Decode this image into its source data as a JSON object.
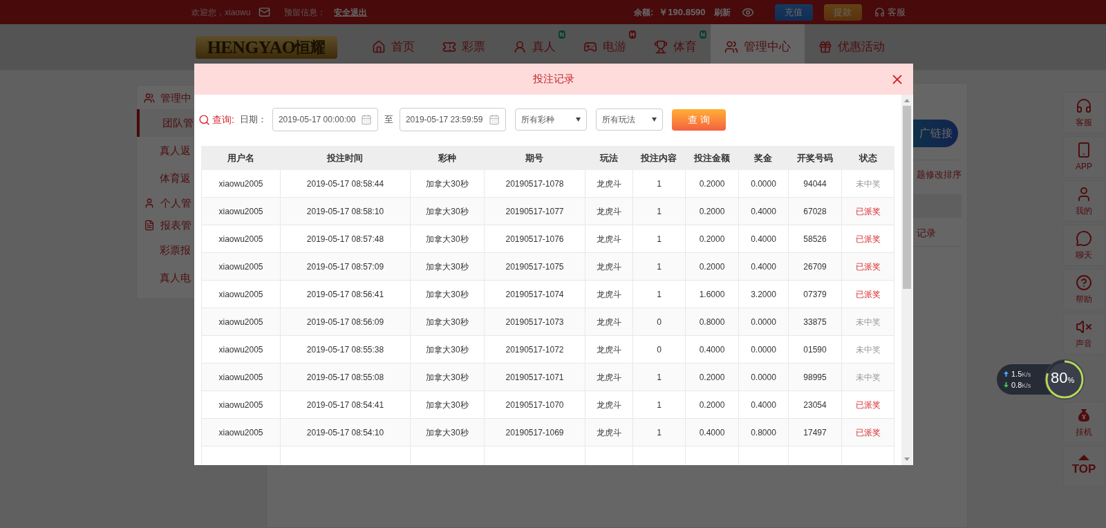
{
  "topbar": {
    "welcome": "欢迎您，xiaowu",
    "reserved_label": "预留信息：",
    "logout": "安全退出",
    "balance_label": "余额:",
    "balance": "￥190.8590",
    "refresh": "刷新",
    "buttons": [
      {
        "label": "充值",
        "kind": "deposit"
      },
      {
        "label": "提款",
        "kind": "withdraw"
      }
    ],
    "service": "客服"
  },
  "logo": {
    "latin": "HENGYAO",
    "cjk": "恒耀"
  },
  "nav": [
    {
      "label": "首页",
      "selected": false
    },
    {
      "label": "彩票",
      "selected": false
    },
    {
      "label": "真人",
      "selected": false,
      "badge": {
        "text": "N",
        "kind": "new"
      }
    },
    {
      "label": "电游",
      "selected": false,
      "badge": {
        "text": "H",
        "kind": "hot"
      }
    },
    {
      "label": "体育",
      "selected": false,
      "badge": {
        "text": "N",
        "kind": "new"
      }
    },
    {
      "label": "管理中心",
      "selected": true
    },
    {
      "label": "优惠活动",
      "selected": false
    }
  ],
  "sidebar": [
    {
      "label": "管理中",
      "children": [
        {
          "label": "团队管",
          "selected": true
        },
        {
          "label": "真人返",
          "selected": false
        },
        {
          "label": "体育返",
          "selected": false
        }
      ]
    },
    {
      "label": "个人管"
    },
    {
      "label": "报表管",
      "children": [
        {
          "label": "彩票报",
          "selected": false
        },
        {
          "label": "真人电",
          "selected": false
        }
      ]
    }
  ],
  "main": {
    "link_button": "广链接",
    "hint": "题修改排序",
    "row_text": "记录"
  },
  "dock": [
    {
      "kind": "item",
      "label": "客服"
    },
    {
      "kind": "item",
      "label": "APP"
    },
    {
      "kind": "item",
      "label": "我的"
    },
    {
      "kind": "item",
      "label": "聊天"
    },
    {
      "kind": "item",
      "label": "帮助"
    },
    {
      "kind": "item",
      "label": "声音"
    },
    {
      "kind": "item",
      "label": "挂机"
    },
    {
      "kind": "top",
      "label": "TOP"
    }
  ],
  "net_widget": {
    "upload": {
      "value": "1.5",
      "unit": "K/s"
    },
    "download": {
      "value": "0.8",
      "unit": "K/s"
    },
    "percent": "80",
    "percent_sign": "%"
  },
  "modal": {
    "title": "投注记录",
    "query_label": "查询:",
    "date_label": "日期：",
    "start": "2019-05-17 00:00:00",
    "separator": "至",
    "end": "2019-05-17 23:59:59",
    "selects": [
      "所有彩种",
      "所有玩法"
    ],
    "button": "查 询",
    "columns": [
      "用户名",
      "投注时间",
      "彩种",
      "期号",
      "玩法",
      "投注内容",
      "投注金额",
      "奖金",
      "开奖号码",
      "状态"
    ],
    "rows": [
      {
        "cells": [
          "xiaowu2005",
          "2019-05-17 08:58:44",
          "加拿大30秒",
          "20190517-1078",
          "龙虎斗",
          "1",
          "0.2000",
          "0.0000",
          "94044",
          "未中奖"
        ],
        "paid": false
      },
      {
        "cells": [
          "xiaowu2005",
          "2019-05-17 08:58:10",
          "加拿大30秒",
          "20190517-1077",
          "龙虎斗",
          "1",
          "0.2000",
          "0.4000",
          "67028",
          "已派奖"
        ],
        "paid": true
      },
      {
        "cells": [
          "xiaowu2005",
          "2019-05-17 08:57:48",
          "加拿大30秒",
          "20190517-1076",
          "龙虎斗",
          "1",
          "0.2000",
          "0.4000",
          "58526",
          "已派奖"
        ],
        "paid": true
      },
      {
        "cells": [
          "xiaowu2005",
          "2019-05-17 08:57:09",
          "加拿大30秒",
          "20190517-1075",
          "龙虎斗",
          "1",
          "0.2000",
          "0.4000",
          "26709",
          "已派奖"
        ],
        "paid": true
      },
      {
        "cells": [
          "xiaowu2005",
          "2019-05-17 08:56:41",
          "加拿大30秒",
          "20190517-1074",
          "龙虎斗",
          "1",
          "1.6000",
          "3.2000",
          "07379",
          "已派奖"
        ],
        "paid": true
      },
      {
        "cells": [
          "xiaowu2005",
          "2019-05-17 08:56:09",
          "加拿大30秒",
          "20190517-1073",
          "龙虎斗",
          "0",
          "0.8000",
          "0.0000",
          "33875",
          "未中奖"
        ],
        "paid": false
      },
      {
        "cells": [
          "xiaowu2005",
          "2019-05-17 08:55:38",
          "加拿大30秒",
          "20190517-1072",
          "龙虎斗",
          "0",
          "0.4000",
          "0.0000",
          "01590",
          "未中奖"
        ],
        "paid": false
      },
      {
        "cells": [
          "xiaowu2005",
          "2019-05-17 08:55:08",
          "加拿大30秒",
          "20190517-1071",
          "龙虎斗",
          "1",
          "0.2000",
          "0.0000",
          "98995",
          "未中奖"
        ],
        "paid": false
      },
      {
        "cells": [
          "xiaowu2005",
          "2019-05-17 08:54:41",
          "加拿大30秒",
          "20190517-1070",
          "龙虎斗",
          "1",
          "0.2000",
          "0.4000",
          "23054",
          "已派奖"
        ],
        "paid": true
      },
      {
        "cells": [
          "xiaowu2005",
          "2019-05-17 08:54:10",
          "加拿大30秒",
          "20190517-1069",
          "龙虎斗",
          "1",
          "0.4000",
          "0.8000",
          "17497",
          "已派奖"
        ],
        "paid": true
      }
    ]
  }
}
